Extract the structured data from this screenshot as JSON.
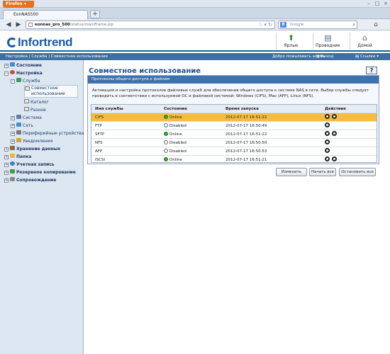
{
  "browser": {
    "menu_button": "Firefox",
    "tab_title": "EonNAS500",
    "url_bold": "eonnas_pro_500",
    "url_rest": "/status/mainFrame.jsp",
    "search_placeholder": "Google"
  },
  "header": {
    "logo_text": "Infortrend",
    "shortcuts_label": "Ярлык",
    "explorer_label": "Проводник",
    "home_label": "Домой"
  },
  "navbar": {
    "breadcrumb": "Настройка | Служба | Совместное использование",
    "welcome": "Добро пожаловать admin",
    "logout": "Выход",
    "links": "Ссылки"
  },
  "sidebar": {
    "status": "Состояние",
    "settings": "Настройка",
    "service": "Служба",
    "sharing_1": "Совместное",
    "sharing_2": "использование",
    "catalog": "Каталог",
    "misc": "Разное",
    "system": "Система",
    "network": "Сеть",
    "peripherals": "Периферийные устройства",
    "notifications": "Уведомления",
    "storage": "Хранение данных",
    "folder": "Папка",
    "account": "Учетная запись",
    "backup": "Резервное копирование",
    "maintenance": "Сопровождение"
  },
  "main": {
    "title": "Совместное использование",
    "help": "?",
    "panel_title": "Протоколы общего доступа к файлам",
    "description": "Активация и настройка протоколов файловых служб для обеспечения общего доступа к системе NAS в сети. Выбор службы следует проводить в соответствии с используемой ОС и файловой системой: Windows (CIFS), Mac (AFP), Linux (NFS).",
    "columns": [
      "Имя службы",
      "Состояние",
      "Время запуска",
      "Действие"
    ],
    "rows": [
      {
        "name": "CIFS",
        "status": "Online",
        "time": "2012-07-17 16:51:22"
      },
      {
        "name": "FTP",
        "status": "Disabled",
        "time": "2012-07-17 16:50:49"
      },
      {
        "name": "SFTP",
        "status": "Online",
        "time": "2012-07-17 16:51:22"
      },
      {
        "name": "NFS",
        "status": "Disabled",
        "time": "2012-07-17 16:50:50"
      },
      {
        "name": "AFP",
        "status": "Disabled",
        "time": "2012-07-17 16:50:53"
      },
      {
        "name": "iSCSI",
        "status": "Online",
        "time": "2012-07-17 16:51:21"
      }
    ],
    "btn_edit": "Изменить",
    "btn_start_all": "Начать все",
    "btn_stop_all": "Остановить все"
  }
}
